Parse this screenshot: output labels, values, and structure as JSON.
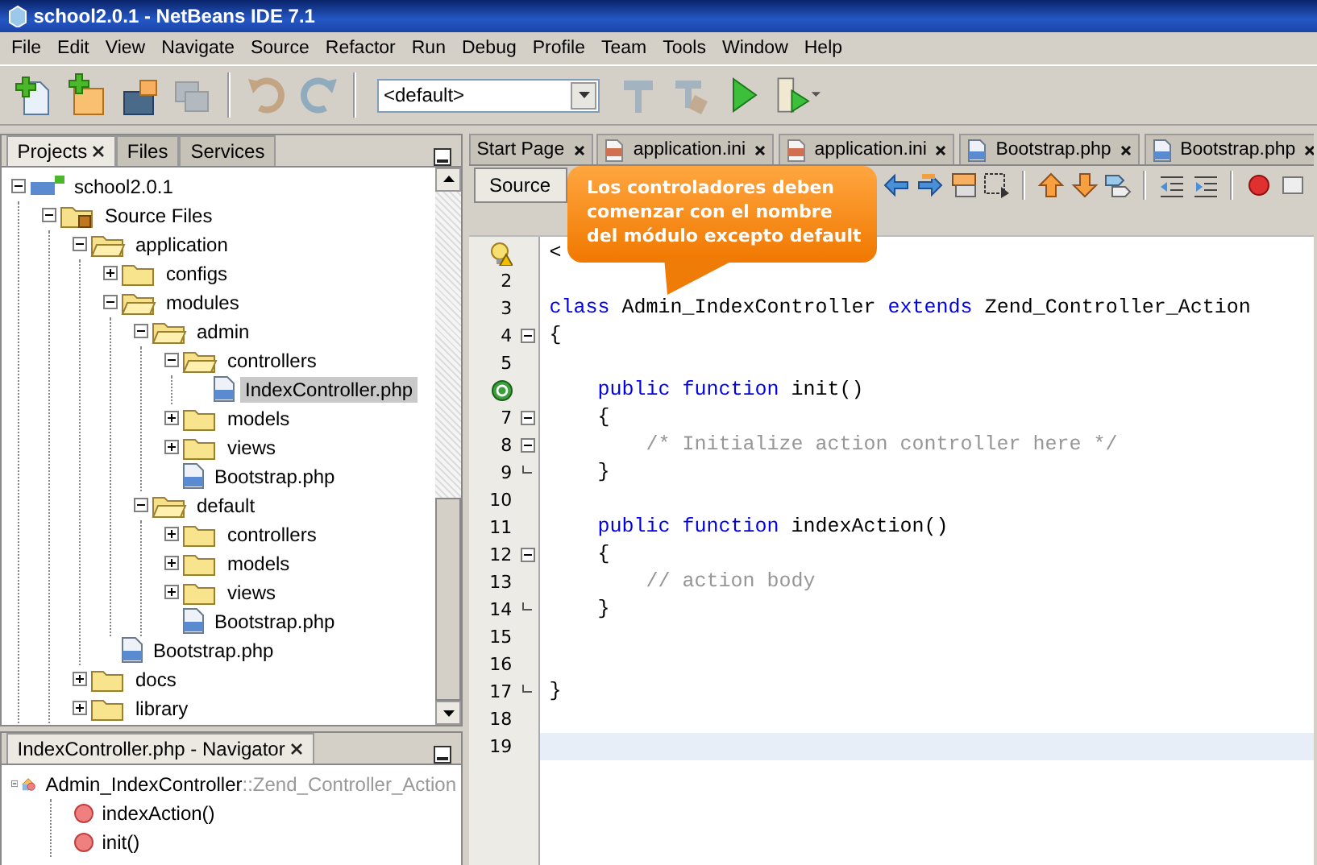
{
  "window": {
    "title": "school2.0.1 - NetBeans IDE 7.1"
  },
  "menu": [
    "File",
    "Edit",
    "View",
    "Navigate",
    "Source",
    "Refactor",
    "Run",
    "Debug",
    "Profile",
    "Team",
    "Tools",
    "Window",
    "Help"
  ],
  "toolbar": [
    {
      "kind": "new-file",
      "disabled": false
    },
    {
      "kind": "new-project",
      "disabled": false
    },
    {
      "kind": "open-project",
      "disabled": false
    },
    {
      "kind": "save-all",
      "disabled": true
    },
    {
      "kind": "sep"
    },
    {
      "kind": "undo",
      "disabled": true
    },
    {
      "kind": "redo",
      "disabled": true
    },
    {
      "kind": "sep"
    },
    {
      "kind": "config",
      "value": "<default>"
    },
    {
      "kind": "build",
      "disabled": true
    },
    {
      "kind": "clean-build",
      "disabled": true
    },
    {
      "kind": "run",
      "disabled": false
    },
    {
      "kind": "debug",
      "disabled": false
    }
  ],
  "projects_panel": {
    "tabs": [
      {
        "label": "Projects",
        "selected": true,
        "closable": true
      },
      {
        "label": "Files",
        "selected": false,
        "closable": false
      },
      {
        "label": "Services",
        "selected": false,
        "closable": false
      }
    ],
    "tree": [
      {
        "label": "school2.0.1",
        "kind": "project",
        "expanded": true,
        "selected": false,
        "children": [
          {
            "label": "Source Files",
            "kind": "source",
            "expanded": true,
            "selected": false,
            "children": [
              {
                "label": "application",
                "kind": "folder",
                "expanded": true,
                "selected": false,
                "children": [
                  {
                    "label": "configs",
                    "kind": "folder",
                    "expanded": false,
                    "selected": false
                  },
                  {
                    "label": "modules",
                    "kind": "folder",
                    "expanded": true,
                    "selected": false,
                    "children": [
                      {
                        "label": "admin",
                        "kind": "folder",
                        "expanded": true,
                        "selected": false,
                        "children": [
                          {
                            "label": "controllers",
                            "kind": "folder",
                            "expanded": true,
                            "selected": false,
                            "children": [
                              {
                                "label": "IndexController.php",
                                "kind": "php",
                                "selected": true
                              }
                            ]
                          },
                          {
                            "label": "models",
                            "kind": "folder",
                            "expanded": false,
                            "selected": false
                          },
                          {
                            "label": "views",
                            "kind": "folder",
                            "expanded": false,
                            "selected": false
                          },
                          {
                            "label": "Bootstrap.php",
                            "kind": "php",
                            "selected": false
                          }
                        ]
                      },
                      {
                        "label": "default",
                        "kind": "folder",
                        "expanded": true,
                        "selected": false,
                        "children": [
                          {
                            "label": "controllers",
                            "kind": "folder",
                            "expanded": false,
                            "selected": false
                          },
                          {
                            "label": "models",
                            "kind": "folder",
                            "expanded": false,
                            "selected": false
                          },
                          {
                            "label": "views",
                            "kind": "folder",
                            "expanded": false,
                            "selected": false
                          },
                          {
                            "label": "Bootstrap.php",
                            "kind": "php",
                            "selected": false
                          }
                        ]
                      }
                    ]
                  },
                  {
                    "label": "Bootstrap.php",
                    "kind": "php",
                    "selected": false
                  }
                ]
              },
              {
                "label": "docs",
                "kind": "folder",
                "expanded": false,
                "selected": false
              },
              {
                "label": "library",
                "kind": "folder",
                "expanded": false,
                "selected": false
              }
            ]
          }
        ]
      }
    ]
  },
  "navigator_panel": {
    "tabs": [
      {
        "label": "IndexController.php - Navigator",
        "selected": true,
        "closable": true
      }
    ],
    "class": {
      "name": "Admin_IndexController",
      "parent": "::Zend_Controller_Action",
      "members": [
        "indexAction()",
        "init()"
      ]
    }
  },
  "editor": {
    "tabs": [
      {
        "label": "Start Page",
        "kind": "page",
        "selected": false
      },
      {
        "label": "application.ini",
        "kind": "ini",
        "selected": false
      },
      {
        "label": "application.ini",
        "kind": "ini",
        "selected": false
      },
      {
        "label": "Bootstrap.php",
        "kind": "php",
        "selected": false
      },
      {
        "label": "Bootstrap.php",
        "kind": "php",
        "selected": false
      }
    ],
    "view_button": {
      "label": "Source",
      "selected": true
    },
    "lines": [
      {
        "kind": "hint",
        "fold_start": false,
        "fold_end": false,
        "segments": [
          {
            "kind": "plain",
            "text": "<"
          }
        ]
      },
      {
        "kind": "code",
        "number": "2",
        "fold_start": false,
        "fold_end": false
      },
      {
        "kind": "code",
        "number": "3",
        "fold_start": false,
        "fold_end": false,
        "segments": [
          {
            "kind": "keyword",
            "text": "class"
          },
          {
            "kind": "plain",
            "text": " Admin_IndexController "
          },
          {
            "kind": "keyword",
            "text": "extends"
          },
          {
            "kind": "plain",
            "text": " Zend_Controller_Action"
          }
        ]
      },
      {
        "kind": "code",
        "number": "4",
        "fold_start": true,
        "fold_end": false,
        "segments": [
          {
            "kind": "plain",
            "text": "{"
          }
        ]
      },
      {
        "kind": "code",
        "number": "5",
        "fold_start": false,
        "fold_end": false
      },
      {
        "kind": "override",
        "fold_start": false,
        "fold_end": false,
        "segments": [
          {
            "kind": "keyword",
            "text": "    public function"
          },
          {
            "kind": "plain",
            "text": " init()"
          }
        ]
      },
      {
        "kind": "code",
        "number": "7",
        "fold_start": true,
        "fold_end": false,
        "segments": [
          {
            "kind": "plain",
            "text": "    {"
          }
        ]
      },
      {
        "kind": "code",
        "number": "8",
        "fold_start": true,
        "fold_end": false,
        "segments": [
          {
            "kind": "comment",
            "text": "        /* Initialize action controller here */"
          }
        ]
      },
      {
        "kind": "code",
        "number": "9",
        "fold_start": false,
        "fold_end": true,
        "segments": [
          {
            "kind": "plain",
            "text": "    }"
          }
        ]
      },
      {
        "kind": "code",
        "number": "10",
        "fold_start": false,
        "fold_end": false
      },
      {
        "kind": "code",
        "number": "11",
        "fold_start": false,
        "fold_end": false,
        "segments": [
          {
            "kind": "keyword",
            "text": "    public function"
          },
          {
            "kind": "plain",
            "text": " indexAction()"
          }
        ]
      },
      {
        "kind": "code",
        "number": "12",
        "fold_start": true,
        "fold_end": false,
        "segments": [
          {
            "kind": "plain",
            "text": "    {"
          }
        ]
      },
      {
        "kind": "code",
        "number": "13",
        "fold_start": false,
        "fold_end": false,
        "segments": [
          {
            "kind": "comment",
            "text": "        // action body"
          }
        ]
      },
      {
        "kind": "code",
        "number": "14",
        "fold_start": false,
        "fold_end": true,
        "segments": [
          {
            "kind": "plain",
            "text": "    }"
          }
        ]
      },
      {
        "kind": "code",
        "number": "15",
        "fold_start": false,
        "fold_end": false
      },
      {
        "kind": "code",
        "number": "16",
        "fold_start": false,
        "fold_end": false
      },
      {
        "kind": "code",
        "number": "17",
        "fold_start": false,
        "fold_end": true,
        "segments": [
          {
            "kind": "plain",
            "text": "}"
          }
        ]
      },
      {
        "kind": "code",
        "number": "18",
        "fold_start": false,
        "fold_end": false
      },
      {
        "kind": "code",
        "number": "19",
        "current": true,
        "fold_start": false,
        "fold_end": false
      }
    ]
  },
  "callout": {
    "text": "Los controladores deben comenzar con el nombre del módulo excepto default"
  }
}
